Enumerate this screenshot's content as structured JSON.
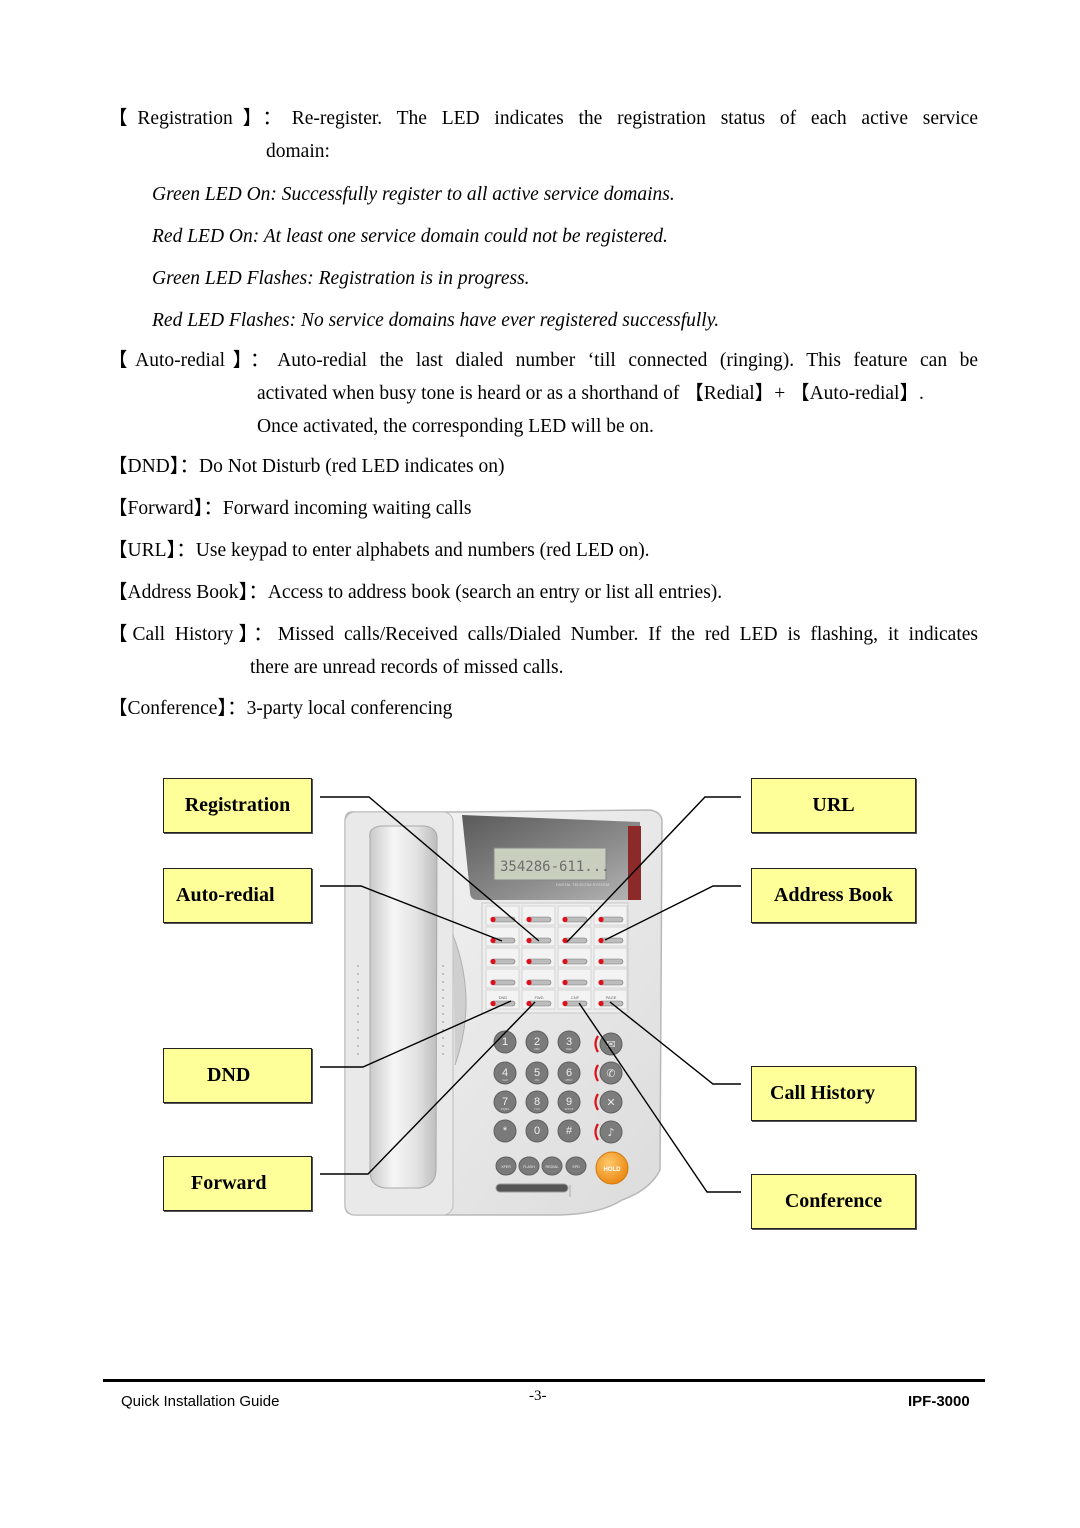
{
  "definitions": [
    {
      "key": "Registration",
      "desc_line1": "Re-register. The LED indicates the registration status of each active service",
      "desc_line2": "domain:",
      "led_states": [
        "Green LED On: Successfully register to all active service domains.",
        "Red LED On: At least one service domain could not be registered.",
        "Green LED Flashes: Registration is in progress.",
        "Red LED Flashes: No service domains have ever registered successfully."
      ]
    },
    {
      "key": "Auto-redial",
      "desc_line1": "Auto-redial the last dialed number ‘till connected (ringing). This feature can be",
      "desc_line2_pre": "activated when busy tone is heard or as a shorthand of ",
      "desc_line2_ref1": "Redial",
      "desc_line2_plus": "+ ",
      "desc_line2_ref2": "Auto-redial",
      "desc_line2_end": ".",
      "desc_line3": "Once activated, the corresponding LED will be on."
    },
    {
      "key": "DND",
      "desc": "Do Not Disturb (red LED indicates on)"
    },
    {
      "key": "Forward",
      "desc": "Forward incoming waiting calls"
    },
    {
      "key": "URL",
      "desc": "Use keypad to enter alphabets and numbers (red LED on)."
    },
    {
      "key": "Address Book",
      "desc": "Access to address book (search an entry or list all entries)."
    },
    {
      "key": "Call History",
      "desc_line1": "Missed calls/Received calls/Dialed Number. If the red LED is flashing, it indicates",
      "desc_line2": "there are unread records of missed calls."
    },
    {
      "key": "Conference",
      "desc": "3-party local conferencing"
    }
  ],
  "bracket_open": "【",
  "bracket_close": "】",
  "colon": "：",
  "diagram": {
    "callouts": {
      "registration": "Registration",
      "auto_redial": "Auto-redial",
      "dnd": "DND",
      "forward": "Forward",
      "url": "URL",
      "address_book": "Address Book",
      "call_history": "Call History",
      "conference": "Conference"
    },
    "phone": {
      "lcd_text": "354286-611...",
      "brand_text": "DIGITAL TELECOM SYSTEM",
      "function_keys": [
        "DND",
        "FWD",
        "CNF",
        "PAGE"
      ],
      "keypad": [
        {
          "digit": "1",
          "letters": ""
        },
        {
          "digit": "2",
          "letters": "ABC"
        },
        {
          "digit": "3",
          "letters": "DEF"
        },
        {
          "digit": "4",
          "letters": "GHI"
        },
        {
          "digit": "5",
          "letters": "JKL"
        },
        {
          "digit": "6",
          "letters": "MNO"
        },
        {
          "digit": "7",
          "letters": "PQRS"
        },
        {
          "digit": "8",
          "letters": "TUV"
        },
        {
          "digit": "9",
          "letters": "WXYZ"
        },
        {
          "digit": "*",
          "letters": ""
        },
        {
          "digit": "0",
          "letters": ""
        },
        {
          "digit": "#",
          "letters": ""
        }
      ],
      "bottom_keys": [
        "XFER",
        "FLASH",
        "REDIAL",
        "SPD"
      ],
      "hold_label": "HOLD",
      "side_icons": [
        "message-icon",
        "handset-icon",
        "mute-icon",
        "speaker-icon"
      ]
    },
    "callout_color": "#ffff99",
    "led_color": "#e0101a",
    "hold_color": "#f39a1e"
  },
  "footer": {
    "left": "Quick Installation Guide",
    "center": "-3-",
    "right": "IPF-3000"
  }
}
